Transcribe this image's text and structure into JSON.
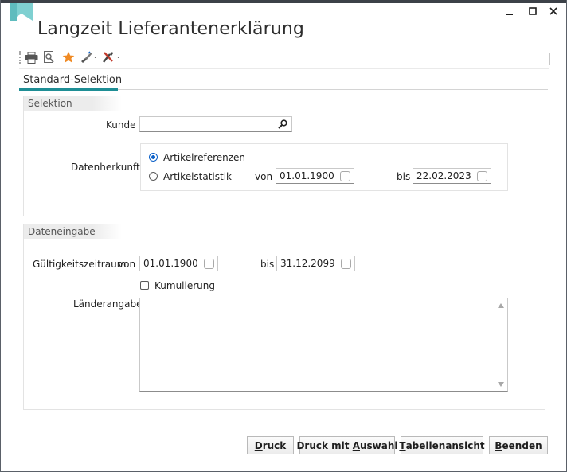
{
  "window": {
    "title": "Langzeit Lieferantenerklärung",
    "controls": {
      "minimize": "–",
      "maximize": "□",
      "close": "✕"
    }
  },
  "toolbar": {
    "icons": [
      "print-icon",
      "preview-icon",
      "favorite-star-icon",
      "brush-dropdown-icon",
      "tools-dropdown-icon"
    ]
  },
  "tabs": [
    {
      "label": "Standard-Selektion",
      "active": true
    }
  ],
  "selektion": {
    "header": "Selektion",
    "kunde": {
      "label": "Kunde",
      "value": ""
    },
    "datenherkunft": {
      "label": "Datenherkunft",
      "options": [
        {
          "label": "Artikelreferenzen",
          "selected": true
        },
        {
          "label": "Artikelstatistik",
          "selected": false
        }
      ],
      "von_label": "von",
      "von_value": "01.01.1900",
      "bis_label": "bis",
      "bis_value": "22.02.2023"
    }
  },
  "dateneingabe": {
    "header": "Dateneingabe",
    "gueltigkeit_label": "Gültigkeitszeitraum",
    "von_label": "von",
    "von_value": "01.01.1900",
    "bis_label": "bis",
    "bis_value": "31.12.2099",
    "kumulierung": {
      "label": "Kumulierung",
      "checked": false
    },
    "laenderangabe": {
      "label": "Länderangabe",
      "value": ""
    }
  },
  "buttons": {
    "druck": {
      "pre": "",
      "ul": "D",
      "post": "ruck"
    },
    "druck_mit_auswahl": {
      "pre": "Druck mit ",
      "ul": "A",
      "post": "uswahl"
    },
    "tabellenansicht": {
      "pre": "",
      "ul": "T",
      "post": "abellenansicht"
    },
    "beenden": {
      "pre": "",
      "ul": "B",
      "post": "eenden"
    }
  },
  "colors": {
    "accent": "#1e8e95",
    "radio": "#0b60c8",
    "star": "#f08a24"
  }
}
